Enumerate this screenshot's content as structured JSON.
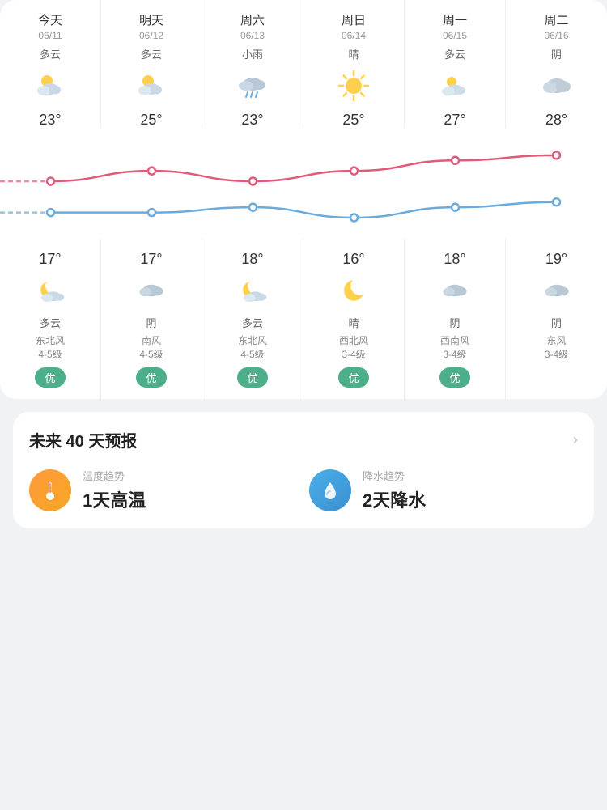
{
  "days": [
    {
      "name": "今天",
      "date": "06/11",
      "condition_day": "多云",
      "high": "23°",
      "low": "17°",
      "condition_night": "多云",
      "wind_dir": "东北风",
      "wind_level": "4-5级",
      "aqi": "优",
      "show_aqi": true,
      "icon_day": "cloudy_sun",
      "icon_night": "cloudy_moon"
    },
    {
      "name": "明天",
      "date": "06/12",
      "condition_day": "多云",
      "high": "25°",
      "low": "17°",
      "condition_night": "阴",
      "wind_dir": "南风",
      "wind_level": "4-5级",
      "aqi": "优",
      "show_aqi": true,
      "icon_day": "cloudy_sun",
      "icon_night": "cloudy"
    },
    {
      "name": "周六",
      "date": "06/13",
      "condition_day": "小雨",
      "high": "23°",
      "low": "18°",
      "condition_night": "多云",
      "wind_dir": "东北风",
      "wind_level": "4-5级",
      "aqi": "优",
      "show_aqi": true,
      "icon_day": "rain",
      "icon_night": "cloudy_moon"
    },
    {
      "name": "周日",
      "date": "06/14",
      "condition_day": "晴",
      "high": "25°",
      "low": "16°",
      "condition_night": "晴",
      "wind_dir": "西北风",
      "wind_level": "3-4级",
      "aqi": "优",
      "show_aqi": true,
      "icon_day": "sunny",
      "icon_night": "moon"
    },
    {
      "name": "周一",
      "date": "06/15",
      "condition_day": "多云",
      "high": "27°",
      "low": "18°",
      "condition_night": "阴",
      "wind_dir": "西南风",
      "wind_level": "3-4级",
      "aqi": "优",
      "show_aqi": true,
      "icon_day": "cloudy_sun_light",
      "icon_night": "cloudy"
    },
    {
      "name": "周二",
      "date": "06/16",
      "condition_day": "阴",
      "high": "28°",
      "low": "19°",
      "condition_night": "阴",
      "wind_dir": "东风",
      "wind_level": "3-4级",
      "aqi": "",
      "show_aqi": false,
      "icon_day": "overcast",
      "icon_night": "cloudy"
    }
  ],
  "chart": {
    "high_points": [
      23,
      25,
      23,
      25,
      27,
      28
    ],
    "low_points": [
      17,
      17,
      18,
      16,
      18,
      19
    ],
    "high_color": "#e05a7a",
    "low_color": "#6aabdd"
  },
  "forecast40": {
    "title": "未来 40 天预报",
    "chevron": "›",
    "temp_trend_label": "温度趋势",
    "temp_trend_value": "1天高温",
    "rain_trend_label": "降水趋势",
    "rain_trend_value": "2天降水"
  }
}
